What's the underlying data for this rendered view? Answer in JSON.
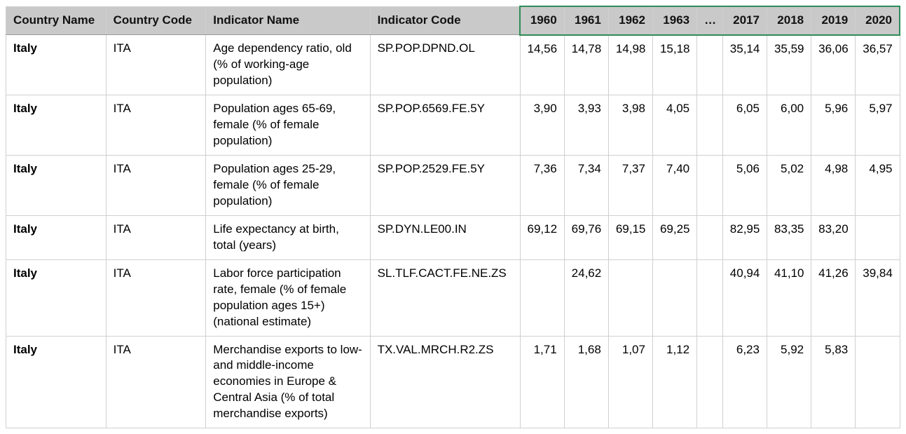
{
  "table": {
    "headers": {
      "country_name": "Country Name",
      "country_code": "Country Code",
      "indicator_name": "Indicator Name",
      "indicator_code": "Indicator Code",
      "y1960": "1960",
      "y1961": "1961",
      "y1962": "1962",
      "y1963": "1963",
      "ellipsis": "…",
      "y2017": "2017",
      "y2018": "2018",
      "y2019": "2019",
      "y2020": "2020"
    },
    "rows": [
      {
        "country_name": "Italy",
        "country_code": "ITA",
        "indicator_name": "Age dependency ratio, old (% of working-age population)",
        "indicator_code": "SP.POP.DPND.OL",
        "y1960": "14,56",
        "y1961": "14,78",
        "y1962": "14,98",
        "y1963": "15,18",
        "y2017": "35,14",
        "y2018": "35,59",
        "y2019": "36,06",
        "y2020": "36,57"
      },
      {
        "country_name": "Italy",
        "country_code": "ITA",
        "indicator_name": "Population ages 65-69, female (% of female population)",
        "indicator_code": "SP.POP.6569.FE.5Y",
        "y1960": "3,90",
        "y1961": "3,93",
        "y1962": "3,98",
        "y1963": "4,05",
        "y2017": "6,05",
        "y2018": "6,00",
        "y2019": "5,96",
        "y2020": "5,97"
      },
      {
        "country_name": "Italy",
        "country_code": "ITA",
        "indicator_name": "Population ages 25-29, female (% of female population)",
        "indicator_code": "SP.POP.2529.FE.5Y",
        "y1960": "7,36",
        "y1961": "7,34",
        "y1962": "7,37",
        "y1963": "7,40",
        "y2017": "5,06",
        "y2018": "5,02",
        "y2019": "4,98",
        "y2020": "4,95"
      },
      {
        "country_name": "Italy",
        "country_code": "ITA",
        "indicator_name": "Life expectancy at birth, total (years)",
        "indicator_code": "SP.DYN.LE00.IN",
        "y1960": "69,12",
        "y1961": "69,76",
        "y1962": "69,15",
        "y1963": "69,25",
        "y2017": "82,95",
        "y2018": "83,35",
        "y2019": "83,20",
        "y2020": ""
      },
      {
        "country_name": "Italy",
        "country_code": "ITA",
        "indicator_name": "Labor force participation rate, female (% of female population ages 15+) (national estimate)",
        "indicator_code": "SL.TLF.CACT.FE.NE.ZS",
        "y1960": "",
        "y1961": "24,62",
        "y1962": "",
        "y1963": "",
        "y2017": "40,94",
        "y2018": "41,10",
        "y2019": "41,26",
        "y2020": "39,84"
      },
      {
        "country_name": "Italy",
        "country_code": "ITA",
        "indicator_name": "Merchandise exports to low- and middle-income economies in Europe & Central Asia (% of total merchandise exports)",
        "indicator_code": "TX.VAL.MRCH.R2.ZS",
        "y1960": "1,71",
        "y1961": "1,68",
        "y1962": "1,07",
        "y1963": "1,12",
        "y2017": "6,23",
        "y2018": "5,92",
        "y2019": "5,83",
        "y2020": ""
      }
    ]
  }
}
